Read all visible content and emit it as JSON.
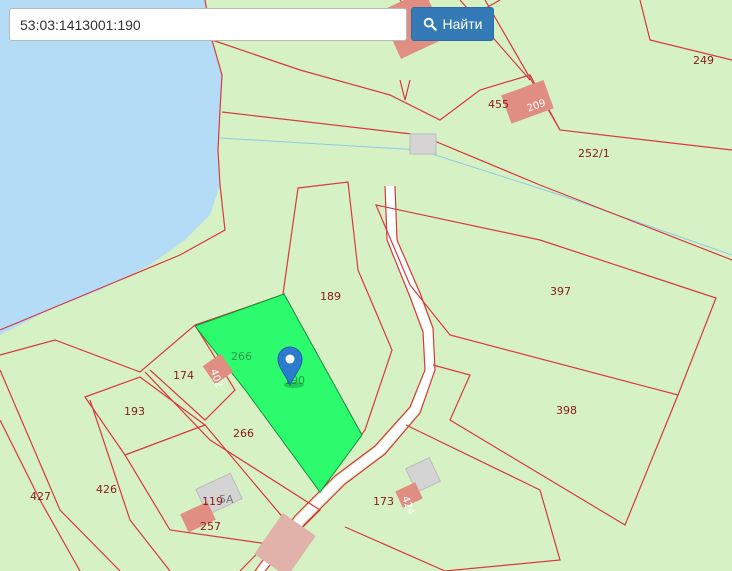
{
  "search": {
    "value": "53:03:1413001:190",
    "button_label": "Найти",
    "button_icon": "search-icon"
  },
  "colors": {
    "background": "#d6f2c4",
    "water": "#b5dcf6",
    "boundary": "#d8383e",
    "selected_parcel": "#2bfb6c",
    "building": "#e08e82",
    "road": "#ffffff",
    "marker": "#2b7ccf",
    "button": "#337ab7"
  },
  "parcels": [
    {
      "label": "249"
    },
    {
      "label": "455"
    },
    {
      "label": "209"
    },
    {
      "label": "252/1"
    },
    {
      "label": "189"
    },
    {
      "label": "397"
    },
    {
      "label": "266"
    },
    {
      "label": "174"
    },
    {
      "label": "402"
    },
    {
      "label": "193"
    },
    {
      "label": "398"
    },
    {
      "label": "266"
    },
    {
      "label": "427"
    },
    {
      "label": "426"
    },
    {
      "label": "119"
    },
    {
      "label": "5A"
    },
    {
      "label": "257"
    },
    {
      "label": "173"
    },
    {
      "label": "424"
    },
    {
      "label": "190"
    }
  ],
  "marker": {
    "icon": "map-pin-icon"
  }
}
